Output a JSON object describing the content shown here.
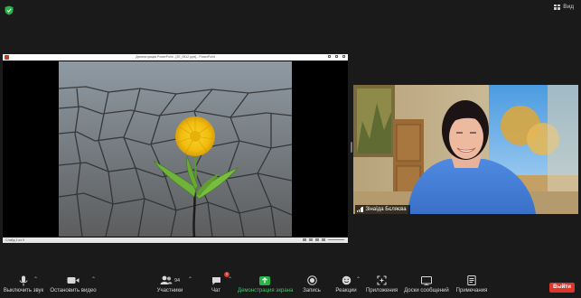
{
  "window": {
    "view_label": "Вид"
  },
  "shared_screen": {
    "title": "Демонстрация PowerPoint - [2E_0512.pptx] - PowerPoint",
    "status_text": "Слайд 1 из 9"
  },
  "participant": {
    "name": "Зінаїда Бєляєва"
  },
  "toolbar": {
    "mute_label": "Выключить звук",
    "video_label": "Остановить видео",
    "participants_label": "Участники",
    "participants_count": "94",
    "chat_label": "Чат",
    "chat_badge": "1",
    "share_label": "Демонстрация экрана",
    "record_label": "Запись",
    "reactions_label": "Реакции",
    "apps_label": "Приложения",
    "whiteboard_label": "Доски сообщений",
    "notes_label": "Примечания",
    "leave_label": "Выйти"
  },
  "colors": {
    "accent_green": "#3dcc6b",
    "leave_red": "#e0352b",
    "background": "#1a1a1a"
  }
}
